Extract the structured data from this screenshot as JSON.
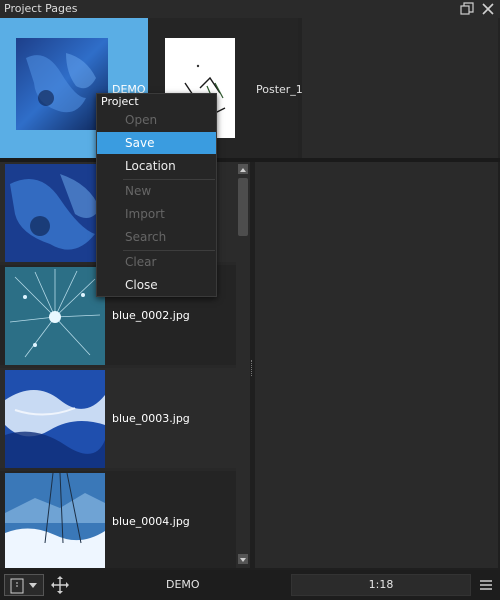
{
  "window": {
    "title": "Project Pages",
    "restore_icon": "restore-window-icon",
    "close_icon": "close-icon"
  },
  "pages": [
    {
      "label": "DEMO",
      "selected": true
    },
    {
      "label": "Poster_1",
      "selected": false
    }
  ],
  "image_list": [
    {
      "name": ""
    },
    {
      "name": "blue_0002.jpg"
    },
    {
      "name": "blue_0003.jpg"
    },
    {
      "name": "blue_0004.jpg"
    }
  ],
  "context_menu": {
    "title": "Project",
    "items": [
      {
        "label": "Open",
        "enabled": false
      },
      {
        "label": "Save",
        "enabled": true,
        "highlighted": true
      },
      {
        "label": "Location",
        "enabled": true
      },
      {
        "label": "New",
        "enabled": false
      },
      {
        "label": "Import",
        "enabled": false
      },
      {
        "label": "Search",
        "enabled": false
      },
      {
        "label": "Clear",
        "enabled": false
      },
      {
        "label": "Close",
        "enabled": true
      }
    ]
  },
  "bottombar": {
    "project_name": "DEMO",
    "aspect_ratio": "1:18",
    "view_icon": "page-view-icon",
    "move_icon": "move-arrows-icon",
    "menu_icon": "hamburger-menu-icon"
  },
  "colors": {
    "accent": "#3a9ce0",
    "selected_page": "#5aaee5",
    "background": "#1f1f1f"
  }
}
